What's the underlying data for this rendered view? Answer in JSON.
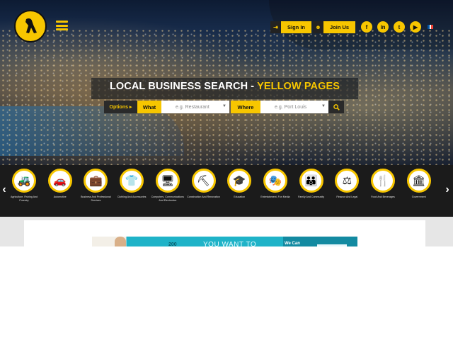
{
  "header": {
    "auth": {
      "signin_label": "Sign In",
      "joinus_label": "Join Us"
    },
    "social": [
      {
        "icon": "facebook-icon",
        "glyph": "f"
      },
      {
        "icon": "linkedin-icon",
        "glyph": "in"
      },
      {
        "icon": "twitter-icon",
        "glyph": "t"
      },
      {
        "icon": "youtube-icon",
        "glyph": "▶"
      }
    ],
    "flag_colors": [
      "#0055a4",
      "#ffffff",
      "#ef4135"
    ]
  },
  "search": {
    "title_main": "LOCAL BUSINESS SEARCH - ",
    "title_brand": "YELLOW PAGES",
    "options_label": "Options ▸",
    "what_label": "What",
    "what_placeholder": "e.g. Restaurant",
    "where_label": "Where",
    "where_placeholder": "e.g. Port Louis"
  },
  "categories": [
    {
      "label": "Agriculture, Fishing And Forestry",
      "icon": "tractor-icon",
      "glyph": "🚜"
    },
    {
      "label": "Automotive",
      "icon": "car-icon",
      "glyph": "🚗"
    },
    {
      "label": "Business And Professional Services",
      "icon": "briefcase-icon",
      "glyph": "💼"
    },
    {
      "label": "Clothing And Accessories",
      "icon": "shirt-icon",
      "glyph": "👕"
    },
    {
      "label": "Computers, Communications And Electronics",
      "icon": "monitor-icon",
      "glyph": "🖥"
    },
    {
      "label": "Construction And Renovation",
      "icon": "worker-icon",
      "glyph": "⛏"
    },
    {
      "label": "Education",
      "icon": "graduation-cap-icon",
      "glyph": "🎓"
    },
    {
      "label": "Entertainment, Fun Media",
      "icon": "theater-masks-icon",
      "glyph": "🎭"
    },
    {
      "label": "Family And Community",
      "icon": "family-icon",
      "glyph": "👪"
    },
    {
      "label": "Finance And Legal",
      "icon": "scales-icon",
      "glyph": "⚖"
    },
    {
      "label": "Food And Beverages",
      "icon": "cutlery-icon",
      "glyph": "🍴"
    },
    {
      "label": "Government",
      "icon": "government-building-icon",
      "glyph": "🏛"
    }
  ],
  "banner": {
    "headline": "YOU WANT TO",
    "side_text": "We Can",
    "logo_text": "200"
  },
  "colors": {
    "brand_yellow": "#f7c600",
    "dark": "#1b1b1b"
  }
}
